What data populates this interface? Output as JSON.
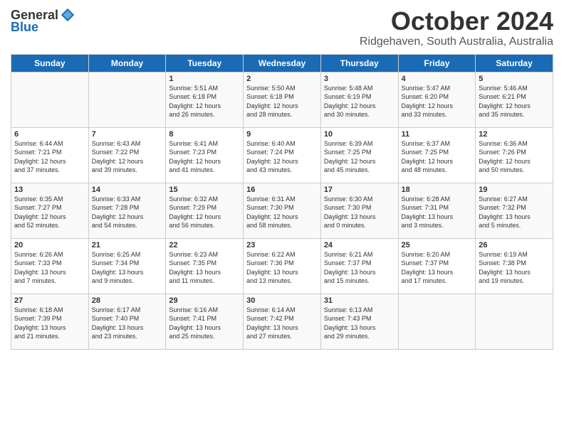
{
  "header": {
    "logo": {
      "general": "General",
      "blue": "Blue"
    },
    "title": "October 2024",
    "location": "Ridgehaven, South Australia, Australia"
  },
  "weekdays": [
    "Sunday",
    "Monday",
    "Tuesday",
    "Wednesday",
    "Thursday",
    "Friday",
    "Saturday"
  ],
  "weeks": [
    [
      {
        "day": "",
        "info": ""
      },
      {
        "day": "",
        "info": ""
      },
      {
        "day": "1",
        "info": "Sunrise: 5:51 AM\nSunset: 6:18 PM\nDaylight: 12 hours\nand 26 minutes."
      },
      {
        "day": "2",
        "info": "Sunrise: 5:50 AM\nSunset: 6:18 PM\nDaylight: 12 hours\nand 28 minutes."
      },
      {
        "day": "3",
        "info": "Sunrise: 5:48 AM\nSunset: 6:19 PM\nDaylight: 12 hours\nand 30 minutes."
      },
      {
        "day": "4",
        "info": "Sunrise: 5:47 AM\nSunset: 6:20 PM\nDaylight: 12 hours\nand 33 minutes."
      },
      {
        "day": "5",
        "info": "Sunrise: 5:46 AM\nSunset: 6:21 PM\nDaylight: 12 hours\nand 35 minutes."
      }
    ],
    [
      {
        "day": "6",
        "info": "Sunrise: 6:44 AM\nSunset: 7:21 PM\nDaylight: 12 hours\nand 37 minutes."
      },
      {
        "day": "7",
        "info": "Sunrise: 6:43 AM\nSunset: 7:22 PM\nDaylight: 12 hours\nand 39 minutes."
      },
      {
        "day": "8",
        "info": "Sunrise: 6:41 AM\nSunset: 7:23 PM\nDaylight: 12 hours\nand 41 minutes."
      },
      {
        "day": "9",
        "info": "Sunrise: 6:40 AM\nSunset: 7:24 PM\nDaylight: 12 hours\nand 43 minutes."
      },
      {
        "day": "10",
        "info": "Sunrise: 6:39 AM\nSunset: 7:25 PM\nDaylight: 12 hours\nand 45 minutes."
      },
      {
        "day": "11",
        "info": "Sunrise: 6:37 AM\nSunset: 7:25 PM\nDaylight: 12 hours\nand 48 minutes."
      },
      {
        "day": "12",
        "info": "Sunrise: 6:36 AM\nSunset: 7:26 PM\nDaylight: 12 hours\nand 50 minutes."
      }
    ],
    [
      {
        "day": "13",
        "info": "Sunrise: 6:35 AM\nSunset: 7:27 PM\nDaylight: 12 hours\nand 52 minutes."
      },
      {
        "day": "14",
        "info": "Sunrise: 6:33 AM\nSunset: 7:28 PM\nDaylight: 12 hours\nand 54 minutes."
      },
      {
        "day": "15",
        "info": "Sunrise: 6:32 AM\nSunset: 7:29 PM\nDaylight: 12 hours\nand 56 minutes."
      },
      {
        "day": "16",
        "info": "Sunrise: 6:31 AM\nSunset: 7:30 PM\nDaylight: 12 hours\nand 58 minutes."
      },
      {
        "day": "17",
        "info": "Sunrise: 6:30 AM\nSunset: 7:30 PM\nDaylight: 13 hours\nand 0 minutes."
      },
      {
        "day": "18",
        "info": "Sunrise: 6:28 AM\nSunset: 7:31 PM\nDaylight: 13 hours\nand 3 minutes."
      },
      {
        "day": "19",
        "info": "Sunrise: 6:27 AM\nSunset: 7:32 PM\nDaylight: 13 hours\nand 5 minutes."
      }
    ],
    [
      {
        "day": "20",
        "info": "Sunrise: 6:26 AM\nSunset: 7:33 PM\nDaylight: 13 hours\nand 7 minutes."
      },
      {
        "day": "21",
        "info": "Sunrise: 6:25 AM\nSunset: 7:34 PM\nDaylight: 13 hours\nand 9 minutes."
      },
      {
        "day": "22",
        "info": "Sunrise: 6:23 AM\nSunset: 7:35 PM\nDaylight: 13 hours\nand 11 minutes."
      },
      {
        "day": "23",
        "info": "Sunrise: 6:22 AM\nSunset: 7:36 PM\nDaylight: 13 hours\nand 13 minutes."
      },
      {
        "day": "24",
        "info": "Sunrise: 6:21 AM\nSunset: 7:37 PM\nDaylight: 13 hours\nand 15 minutes."
      },
      {
        "day": "25",
        "info": "Sunrise: 6:20 AM\nSunset: 7:37 PM\nDaylight: 13 hours\nand 17 minutes."
      },
      {
        "day": "26",
        "info": "Sunrise: 6:19 AM\nSunset: 7:38 PM\nDaylight: 13 hours\nand 19 minutes."
      }
    ],
    [
      {
        "day": "27",
        "info": "Sunrise: 6:18 AM\nSunset: 7:39 PM\nDaylight: 13 hours\nand 21 minutes."
      },
      {
        "day": "28",
        "info": "Sunrise: 6:17 AM\nSunset: 7:40 PM\nDaylight: 13 hours\nand 23 minutes."
      },
      {
        "day": "29",
        "info": "Sunrise: 6:16 AM\nSunset: 7:41 PM\nDaylight: 13 hours\nand 25 minutes."
      },
      {
        "day": "30",
        "info": "Sunrise: 6:14 AM\nSunset: 7:42 PM\nDaylight: 13 hours\nand 27 minutes."
      },
      {
        "day": "31",
        "info": "Sunrise: 6:13 AM\nSunset: 7:43 PM\nDaylight: 13 hours\nand 29 minutes."
      },
      {
        "day": "",
        "info": ""
      },
      {
        "day": "",
        "info": ""
      }
    ]
  ]
}
